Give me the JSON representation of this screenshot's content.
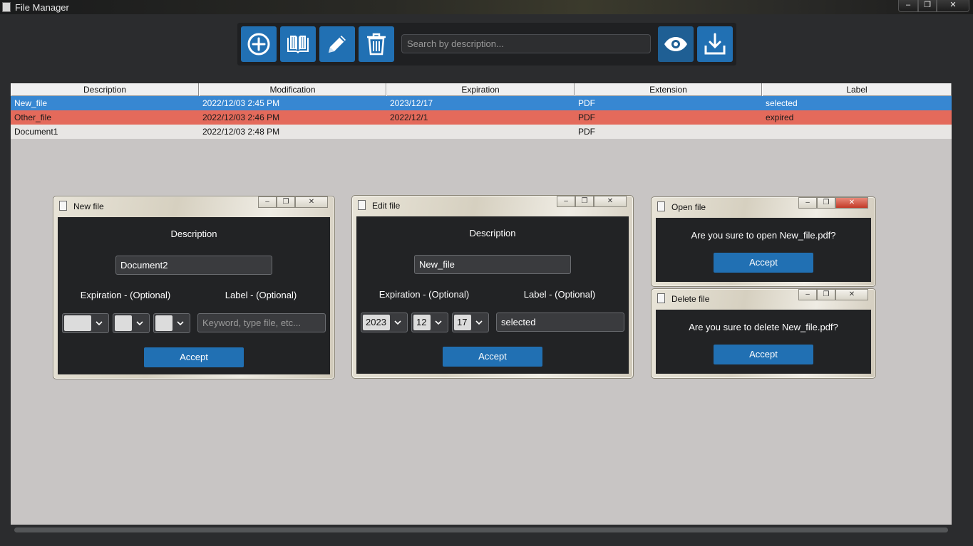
{
  "window": {
    "title": "File Manager",
    "controls": [
      "–",
      "❐",
      "✕"
    ]
  },
  "toolbar": {
    "buttons": [
      {
        "name": "add-button",
        "icon": "plus-circle-icon"
      },
      {
        "name": "open-book-button",
        "icon": "book-icon"
      },
      {
        "name": "edit-button",
        "icon": "pencil-icon"
      },
      {
        "name": "delete-button",
        "icon": "trash-icon"
      },
      {
        "name": "view-button",
        "icon": "eye-icon"
      },
      {
        "name": "download-button",
        "icon": "download-icon"
      }
    ],
    "search_placeholder": "Search by description..."
  },
  "table": {
    "columns": [
      "Description",
      "Modification",
      "Expiration",
      "Extension",
      "Label"
    ],
    "rows": [
      {
        "description": "New_file",
        "modification": "2022/12/03 2:45 PM",
        "expiration": "2023/12/17",
        "extension": "PDF",
        "label": "selected",
        "state": "selected"
      },
      {
        "description": "Other_file",
        "modification": "2022/12/03 2:46 PM",
        "expiration": "2022/12/1",
        "extension": "PDF",
        "label": "expired",
        "state": "expired"
      },
      {
        "description": "Document1",
        "modification": "2022/12/03 2:48 PM",
        "expiration": "",
        "extension": "PDF",
        "label": "",
        "state": "normal"
      }
    ]
  },
  "new_dialog": {
    "title": "New file",
    "description_label": "Description",
    "description_value": "Document2",
    "expiration_label": "Expiration - (Optional)",
    "label_label": "Label - (Optional)",
    "label_placeholder": "Keyword, type file, etc...",
    "accept": "Accept"
  },
  "edit_dialog": {
    "title": "Edit file",
    "description_label": "Description",
    "description_value": "New_file",
    "expiration_label": "Expiration - (Optional)",
    "label_label": "Label - (Optional)",
    "year": "2023",
    "month": "12",
    "day": "17",
    "label_value": "selected",
    "accept": "Accept"
  },
  "open_dialog": {
    "title": "Open file",
    "message": "Are you sure to open New_file.pdf?",
    "accept": "Accept"
  },
  "delete_dialog": {
    "title": "Delete file",
    "message": "Are you sure to delete New_file.pdf?",
    "accept": "Accept"
  },
  "colors": {
    "accent": "#2170b3",
    "selected_row": "#3787d2",
    "expired_row": "#e46a5b",
    "panel": "#c8c5c4",
    "background": "#2b2c2e"
  }
}
